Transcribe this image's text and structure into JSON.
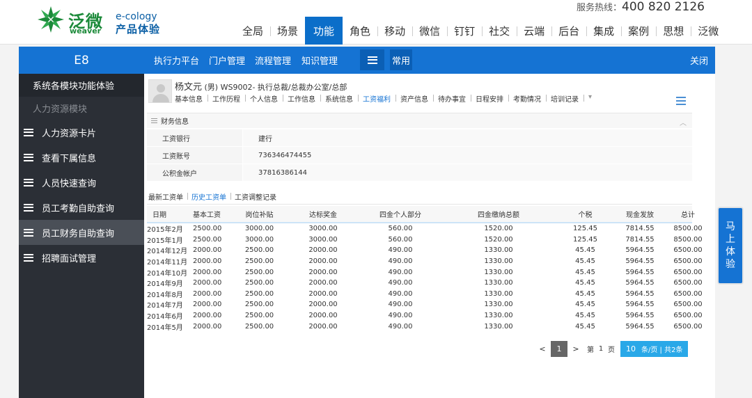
{
  "brand": {
    "logo_cn": "泛微",
    "logo_en": "weaver",
    "product_en": "e-cology",
    "product_cn": "产品体验",
    "hotline_label": "服务热线：",
    "hotline_number": "400 820 2126",
    "green": "#1c8a3a",
    "blue": "#0b5fa5"
  },
  "main_nav": [
    "全局",
    "场景",
    "功能",
    "角色",
    "移动",
    "微信",
    "钉钉",
    "社交",
    "云端",
    "后台",
    "集成",
    "案例",
    "思想",
    "泛微"
  ],
  "main_nav_active": "功能",
  "app": {
    "side_title": "E8",
    "side_section": "系统各模块功能体验",
    "side_group": "人力资源模块",
    "side_items": [
      "人力资源卡片",
      "查看下属信息",
      "人员快速查询",
      "员工考勤自助查询",
      "员工财务自助查询",
      "招聘面试管理"
    ],
    "side_active": "员工财务自助查询",
    "top_menu": [
      "执行力平台",
      "门户管理",
      "流程管理",
      "知识管理"
    ],
    "common_label": "常用",
    "close_label": "关闭",
    "accent": "#1573d3"
  },
  "employee": {
    "name": "杨文元",
    "gender": "(男)",
    "info": "WS9002- 执行总裁/总裁办公室/总部",
    "tabs": [
      "基本信息",
      "工作历程",
      "个人信息",
      "工作信息",
      "系统信息",
      "工资福利",
      "资产信息",
      "待办事宜",
      "日程安排",
      "考勤情况",
      "培训记录"
    ],
    "active_tab": "工资福利",
    "more_icon": "▾"
  },
  "finance": {
    "title": "财务信息",
    "collapse_icon": "︿",
    "rows": [
      {
        "label": "工资银行",
        "value": "建行"
      },
      {
        "label": "工资账号",
        "value": "736346474455"
      },
      {
        "label": "公积金帐户",
        "value": "37816386144"
      }
    ]
  },
  "salary_tabs": [
    "最新工资单",
    "历史工资单",
    "工资调整记录"
  ],
  "salary_active": "历史工资单",
  "salary_table": {
    "headers": [
      "日期",
      "基本工资",
      "岗位补贴",
      "达标奖金",
      "四金个人部分",
      "四金缴纳总额",
      "个税",
      "现金发放",
      "总计"
    ],
    "rows": [
      [
        "2015年2月",
        "2500.00",
        "3000.00",
        "3000.00",
        "560.00",
        "1520.00",
        "125.45",
        "7814.55",
        "8500.00"
      ],
      [
        "2015年1月",
        "2500.00",
        "3000.00",
        "3000.00",
        "560.00",
        "1520.00",
        "125.45",
        "7814.55",
        "8500.00"
      ],
      [
        "2014年12月",
        "2000.00",
        "2500.00",
        "2000.00",
        "490.00",
        "1330.00",
        "45.45",
        "5964.55",
        "6500.00"
      ],
      [
        "2014年11月",
        "2000.00",
        "2500.00",
        "2000.00",
        "490.00",
        "1330.00",
        "45.45",
        "5964.55",
        "6500.00"
      ],
      [
        "2014年10月",
        "2000.00",
        "2500.00",
        "2000.00",
        "490.00",
        "1330.00",
        "45.45",
        "5964.55",
        "6500.00"
      ],
      [
        "2014年9月",
        "2000.00",
        "2500.00",
        "2000.00",
        "490.00",
        "1330.00",
        "45.45",
        "5964.55",
        "6500.00"
      ],
      [
        "2014年8月",
        "2000.00",
        "2500.00",
        "2000.00",
        "490.00",
        "1330.00",
        "45.45",
        "5964.55",
        "6500.00"
      ],
      [
        "2014年7月",
        "2000.00",
        "2500.00",
        "2000.00",
        "490.00",
        "1330.00",
        "45.45",
        "5964.55",
        "6500.00"
      ],
      [
        "2014年6月",
        "2000.00",
        "2500.00",
        "2000.00",
        "490.00",
        "1330.00",
        "45.45",
        "5964.55",
        "6500.00"
      ],
      [
        "2014年5月",
        "2000.00",
        "2500.00",
        "2000.00",
        "490.00",
        "1330.00",
        "45.45",
        "5964.55",
        "6500.00"
      ]
    ]
  },
  "pager": {
    "prev": "<",
    "current": "1",
    "next": ">",
    "goto_prefix": "第",
    "goto_value": "1",
    "goto_suffix": "页",
    "page_size": "10",
    "page_size_label": "条/页 | 共2条"
  },
  "try_button": "马上体验"
}
